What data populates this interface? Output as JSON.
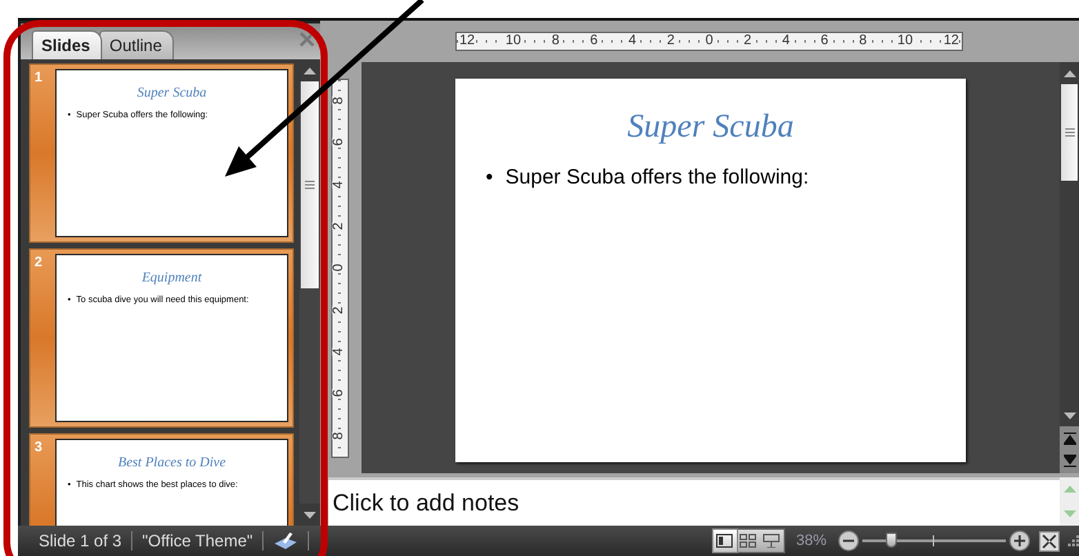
{
  "pane_tabs": [
    {
      "label": "Slides",
      "selected": true
    },
    {
      "label": "Outline",
      "selected": false
    }
  ],
  "slides": [
    {
      "number": "1",
      "title": "Super Scuba",
      "bullet_mark": "•",
      "bullet": "Super Scuba offers the following:",
      "selected": true
    },
    {
      "number": "2",
      "title": "Equipment",
      "bullet_mark": "•",
      "bullet": "To scuba dive you will need this equipment:",
      "selected": true
    },
    {
      "number": "3",
      "title": "Best Places to Dive",
      "bullet_mark": "•",
      "bullet": "This chart shows the best places to dive:",
      "selected": true
    }
  ],
  "ruler_h": [
    "12",
    "10",
    "8",
    "6",
    "4",
    "2",
    "0",
    "2",
    "4",
    "6",
    "8",
    "10",
    "12"
  ],
  "ruler_v": [
    "8",
    "6",
    "4",
    "2",
    "0",
    "2",
    "4",
    "6",
    "8"
  ],
  "current_slide": {
    "title": "Super Scuba",
    "bullet_mark": "•",
    "bullet": "Super Scuba offers the following:"
  },
  "notes": {
    "placeholder": "Click to add notes"
  },
  "status_bar": {
    "slide_info": "Slide 1 of 3",
    "theme": "\"Office Theme\"",
    "views": [
      {
        "kind": "normal",
        "selected": true
      },
      {
        "kind": "sorter",
        "selected": false
      },
      {
        "kind": "show",
        "selected": false
      }
    ],
    "zoom": "38%",
    "zoom_slider": {
      "level": 0.2
    }
  }
}
